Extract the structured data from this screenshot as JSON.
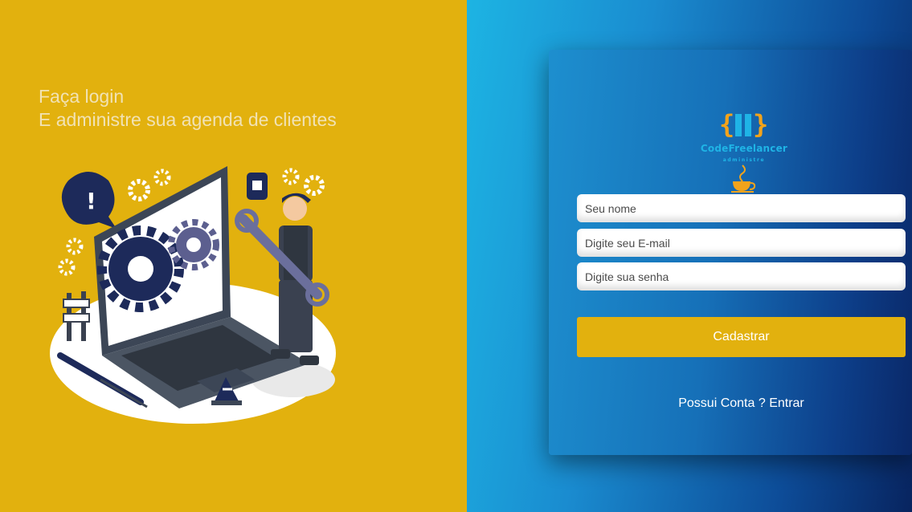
{
  "hero": {
    "line1": "Faça login",
    "line2": "E administre sua agenda de clientes"
  },
  "illustration": {
    "icon": "repair-technician-laptop-illustration"
  },
  "logo": {
    "name": "CodeFreelancer",
    "tagline": "administre",
    "icon": "code-brackets-coffee-icon"
  },
  "form": {
    "name_placeholder": "Seu nome",
    "email_placeholder": "Digite seu E-mail",
    "password_placeholder": "Digite sua senha",
    "name_value": "",
    "email_value": "",
    "password_value": "",
    "submit_label": "Cadastrar",
    "login_prompt": "Possui Conta ? Entrar"
  },
  "colors": {
    "accent": "#e2b10e",
    "brand_blue": "#1fb4e6",
    "card_dark": "#0a2868",
    "headline_text": "#f1e2b4"
  }
}
